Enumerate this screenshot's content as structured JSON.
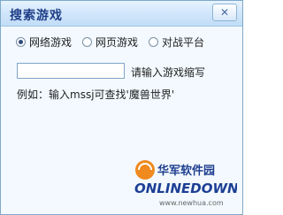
{
  "dialog": {
    "title": "搜索游戏",
    "close_icon": "close-icon"
  },
  "radio_group": {
    "options": [
      {
        "label": "网络游戏",
        "checked": true
      },
      {
        "label": "网页游戏",
        "checked": false
      },
      {
        "label": "对战平台",
        "checked": false
      }
    ]
  },
  "search": {
    "value": "",
    "hint": "请输入游戏缩写"
  },
  "example_text": "例如：输入mssj可查找'魔兽世界'",
  "watermark": {
    "cn_text": "华军软件园",
    "logo_text": "ONLINEDOWN",
    "url": "www.newhua.com"
  }
}
